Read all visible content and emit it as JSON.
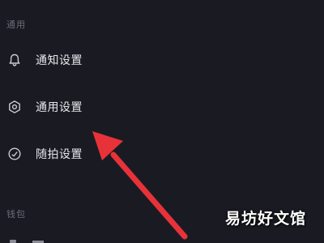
{
  "sections": {
    "general": {
      "header": "通用",
      "items": [
        {
          "label": "通知设置",
          "icon": "bell-icon"
        },
        {
          "label": "通用设置",
          "icon": "gear-icon"
        },
        {
          "label": "随拍设置",
          "icon": "check-circle-icon"
        }
      ]
    },
    "wallet": {
      "header": "钱包"
    }
  },
  "annotation": {
    "arrow_color": "#e8323a",
    "target": "通用设置"
  },
  "watermark": "易坊好文馆",
  "colors": {
    "background": "#1a1b22",
    "text": "#e6e6ea",
    "header": "#6a6c78",
    "icon": "#c9cad2"
  }
}
